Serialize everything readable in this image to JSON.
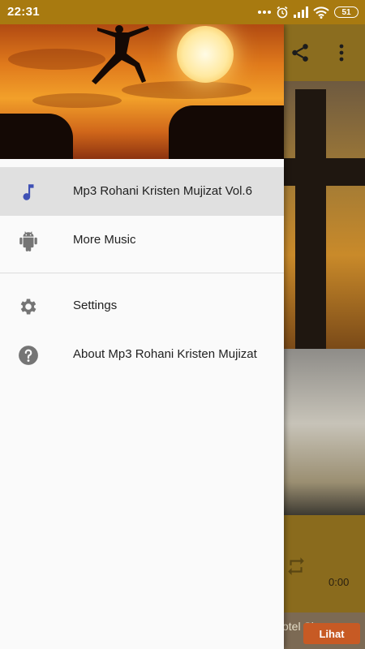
{
  "status_bar": {
    "time": "22:31",
    "battery": "51"
  },
  "drawer": {
    "items": [
      {
        "label": "Mp3 Rohani Kristen Mujizat Vol.6",
        "icon": "music-note-icon",
        "active": true
      },
      {
        "label": "More Music",
        "icon": "android-icon",
        "active": false
      }
    ],
    "secondary_items": [
      {
        "label": "Settings",
        "icon": "gear-icon"
      },
      {
        "label": "About Mp3 Rohani Kristen Mujizat",
        "icon": "help-icon"
      }
    ]
  },
  "background_app": {
    "player_time": "0:00",
    "ad_text": "otel Singapore",
    "ad_button": "Lihat"
  },
  "colors": {
    "status_bar": "#a87a10",
    "accent": "#3f51b5",
    "active_item": "#e0e0e0",
    "icon_gray": "#757575",
    "ad_button": "#c75a24"
  }
}
